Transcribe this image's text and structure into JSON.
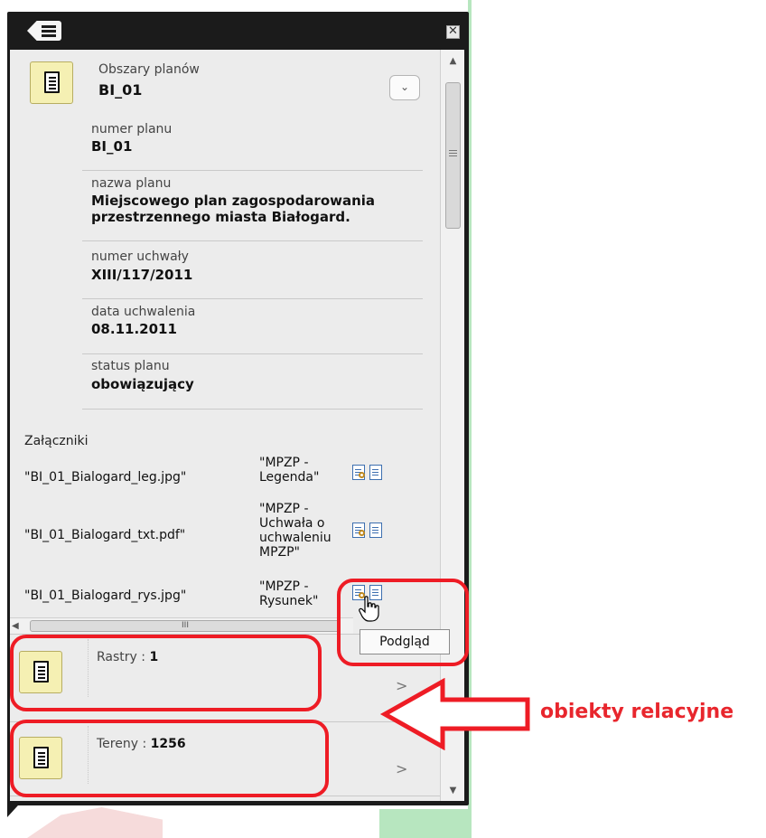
{
  "panel": {
    "layer_title": "Obszary planów",
    "object_id": "BI_01",
    "dropdown_glyph": "⌄",
    "close_glyph": "✕"
  },
  "fields": [
    {
      "label": "numer planu",
      "value": "BI_01"
    },
    {
      "label": "nazwa planu",
      "value": "Miejscowego plan zagospodarowania przestrzennego miasta Białogard."
    },
    {
      "label": "numer uchwały",
      "value": "XIII/117/2011"
    },
    {
      "label": "data uchwalenia",
      "value": "08.11.2011"
    },
    {
      "label": "status planu",
      "value": "obowiązujący"
    }
  ],
  "attachments": {
    "heading": "Załączniki",
    "items": [
      {
        "file": "\"BI_01_Bialogard_leg.jpg\"",
        "desc": "\"MPZP - Legenda\""
      },
      {
        "file": "\"BI_01_Bialogard_txt.pdf\"",
        "desc": "\"MPZP - Uchwała o uchwaleniu MPZP\""
      },
      {
        "file": "\"BI_01_Bialogard_rys.jpg\"",
        "desc": "\"MPZP - Rysunek\""
      }
    ]
  },
  "tooltip": "Podgląd",
  "scroll": {
    "thumb_grip": "III"
  },
  "relations": [
    {
      "name": "Rastry :",
      "count": "1"
    },
    {
      "name": "Tereny :",
      "count": "1256"
    }
  ],
  "annotation": {
    "label": "obiekty relacyjne",
    "color": "#ee1c25"
  },
  "colors": {
    "panel_frame": "#1b1b1b",
    "content_bg": "#ececec",
    "icon_bg": "#f5f0b3"
  }
}
